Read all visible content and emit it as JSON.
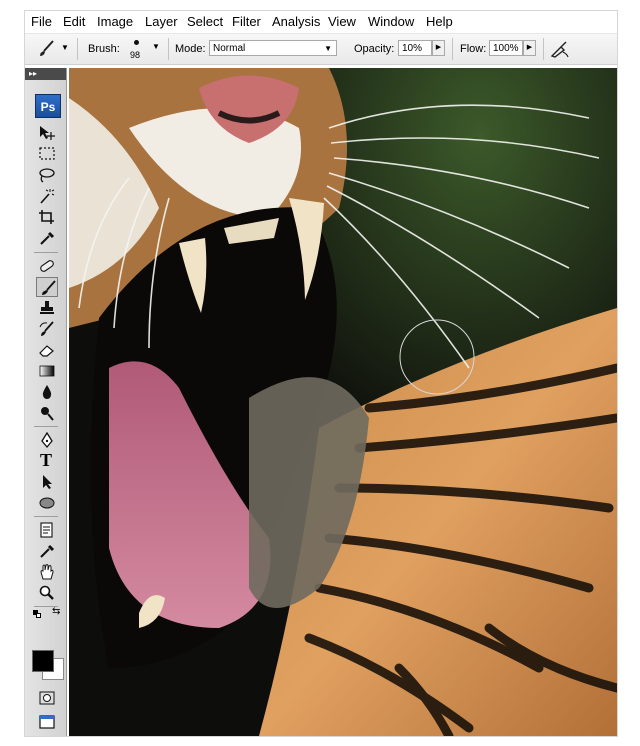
{
  "menu": [
    "File",
    "Edit",
    "Image",
    "Layer",
    "Select",
    "Filter",
    "Analysis",
    "View",
    "Window",
    "Help"
  ],
  "options": {
    "brush_label": "Brush:",
    "brush_size": "98",
    "mode_label": "Mode:",
    "mode_value": "Normal",
    "opacity_label": "Opacity:",
    "opacity_value": "10%",
    "flow_label": "Flow:",
    "flow_value": "100%"
  },
  "toolbox": {
    "collapse_glyph": "▸▸",
    "logo": "Ps",
    "active_tool": "brush-tool",
    "tools": [
      "move",
      "marquee",
      "lasso",
      "magic-wand",
      "crop",
      "eyedropper",
      "healing",
      "brush",
      "clone-stamp",
      "history-brush",
      "eraser",
      "gradient",
      "blur",
      "dodge",
      "pen",
      "type",
      "path-selection",
      "ellipse",
      "notes",
      "eyedropper-2",
      "hand",
      "zoom"
    ]
  },
  "colors": {
    "foreground": "#000000",
    "background": "#ffffff",
    "accent": "#1a4d9d"
  }
}
